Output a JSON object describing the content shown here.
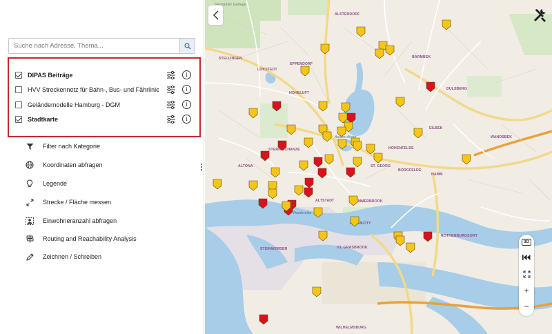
{
  "search": {
    "placeholder": "Suche nach Adresse, Thema..."
  },
  "layers": [
    {
      "name": "DIPAS Beiträge",
      "checked": true,
      "bold": true
    },
    {
      "name": "HVV Streckennetz für Bahn-, Bus- und Fährlinien ...",
      "checked": false,
      "bold": false
    },
    {
      "name": "Geländemodelle Hamburg - DGM",
      "checked": false,
      "bold": false
    },
    {
      "name": "Stadtkarte",
      "checked": true,
      "bold": true
    }
  ],
  "tools": [
    {
      "label": "Filter nach Kategorie",
      "icon": "funnel-icon"
    },
    {
      "label": "Koordinaten abfragen",
      "icon": "globe-icon"
    },
    {
      "label": "Legende",
      "icon": "lightbulb-icon"
    },
    {
      "label": "Strecke / Fläche messen",
      "icon": "expand-arrows-icon"
    },
    {
      "label": "Einwohneranzahl abfragen",
      "icon": "person-frame-icon"
    },
    {
      "label": "Routing and Reachability Analysis",
      "icon": "signpost-icon"
    },
    {
      "label": "Zeichnen / Schreiben",
      "icon": "pencil-icon"
    }
  ],
  "map": {
    "controls": {
      "btn_3d": "3D",
      "zoom_in": "+",
      "zoom_out": "−"
    },
    "labels": {
      "niendorf": "Niendorfer Gehege",
      "stellingen": "STELLINGEN",
      "alsterdorf": "ALSTERDORF",
      "barmbek": "BARMBEK",
      "eppendorf": "EPPENDORF",
      "lokstedt": "LOKSTEDT",
      "hoheluft": "HOHELUFT",
      "dulsberg": "DULSBERG",
      "eilbek": "EILBEK",
      "wandsbek": "WANDSBEK",
      "hohenfelde": "HOHENFELDE",
      "altona": "ALTONA",
      "sternschanze": "STERN-SCHANZE",
      "stgeorg": "ST. GEORG",
      "borgfelde": "BORGFELDE",
      "hamm": "HAMM",
      "altstadt": "ALTSTADT",
      "hammerbrook": "HAMMERBROOK",
      "hafencity": "HAFENCITY",
      "rothenburgsort": "ROTHENBURGSORT",
      "steinwerder": "STEINWERDER",
      "grasbrook": "KL GRASBROOK",
      "wilhelmsburg": "WILHELMSBURG",
      "alster": "Außen-Alster",
      "elbe": "Norderelbe"
    },
    "colors": {
      "yellow_marker": "#f5c518",
      "red_marker": "#d9121f",
      "water": "#a7cde8",
      "highlight": "#c8282b"
    }
  }
}
